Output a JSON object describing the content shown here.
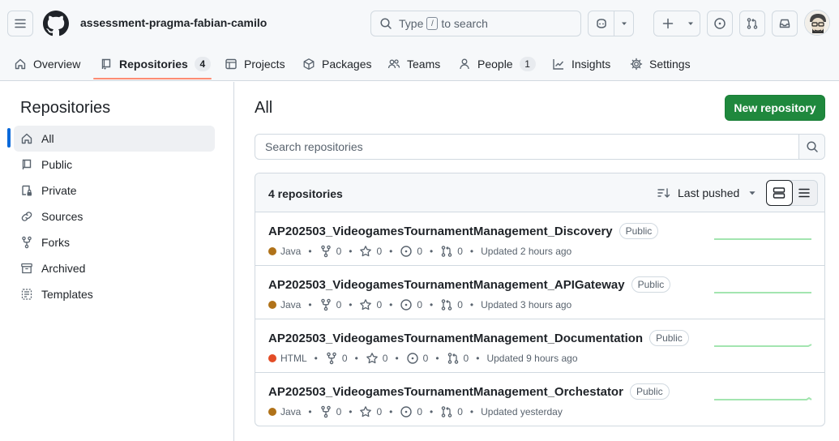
{
  "header": {
    "org_name": "assessment-pragma-fabian-camilo",
    "search": {
      "prefix": "Type",
      "key": "/",
      "suffix": "to search"
    }
  },
  "nav_tabs": [
    {
      "label": "Overview",
      "icon": "home-icon"
    },
    {
      "label": "Repositories",
      "icon": "repo-icon",
      "count": "4",
      "selected": true
    },
    {
      "label": "Projects",
      "icon": "table-icon"
    },
    {
      "label": "Packages",
      "icon": "package-icon"
    },
    {
      "label": "Teams",
      "icon": "people-icon"
    },
    {
      "label": "People",
      "icon": "person-icon",
      "count": "1"
    },
    {
      "label": "Insights",
      "icon": "graph-icon"
    },
    {
      "label": "Settings",
      "icon": "gear-icon"
    }
  ],
  "sidebar": {
    "title": "Repositories",
    "items": [
      {
        "label": "All",
        "icon": "home-icon",
        "active": true
      },
      {
        "label": "Public",
        "icon": "repo-icon"
      },
      {
        "label": "Private",
        "icon": "lock-icon"
      },
      {
        "label": "Sources",
        "icon": "link-icon"
      },
      {
        "label": "Forks",
        "icon": "fork-icon"
      },
      {
        "label": "Archived",
        "icon": "archive-icon"
      },
      {
        "label": "Templates",
        "icon": "template-icon"
      }
    ]
  },
  "main": {
    "title": "All",
    "new_button": "New repository",
    "search_placeholder": "Search repositories",
    "count_label": "4 repositories",
    "sort_label": "Last pushed"
  },
  "repos": [
    {
      "name": "AP202503_VideogamesTournamentManagement_Discovery",
      "visibility": "Public",
      "language": "Java",
      "lang_color": "#b07219",
      "forks": "0",
      "stars": "0",
      "issues": "0",
      "prs": "0",
      "updated": "Updated 2 hours ago"
    },
    {
      "name": "AP202503_VideogamesTournamentManagement_APIGateway",
      "visibility": "Public",
      "language": "Java",
      "lang_color": "#b07219",
      "forks": "0",
      "stars": "0",
      "issues": "0",
      "prs": "0",
      "updated": "Updated 3 hours ago"
    },
    {
      "name": "AP202503_VideogamesTournamentManagement_Documentation",
      "visibility": "Public",
      "language": "HTML",
      "lang_color": "#e34c26",
      "forks": "0",
      "stars": "0",
      "issues": "0",
      "prs": "0",
      "updated": "Updated 9 hours ago"
    },
    {
      "name": "AP202503_VideogamesTournamentManagement_Orchestator",
      "visibility": "Public",
      "language": "Java",
      "lang_color": "#b07219",
      "forks": "0",
      "stars": "0",
      "issues": "0",
      "prs": "0",
      "updated": "Updated yesterday"
    }
  ],
  "colors": {
    "accent_green": "#1f883d",
    "tab_underline": "#fd8c73",
    "spark": "#a3e5b0"
  }
}
